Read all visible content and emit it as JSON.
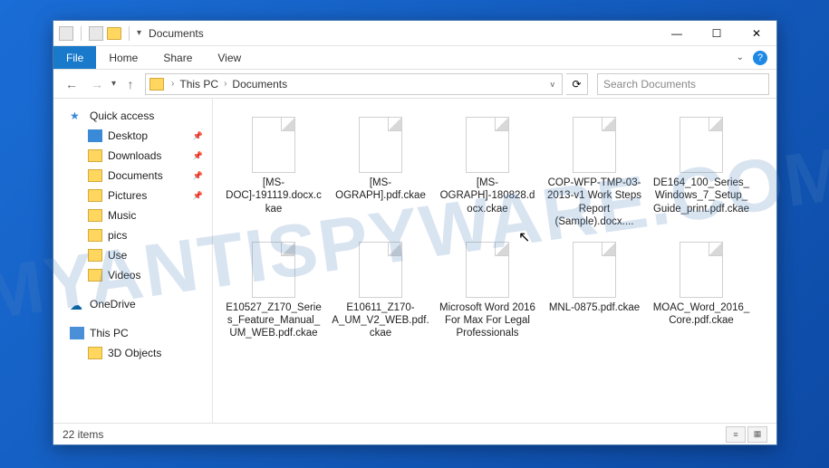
{
  "watermark": "MYANTISPYWARE.COM",
  "window": {
    "title": "Documents"
  },
  "ribbon": {
    "file": "File",
    "tabs": [
      "Home",
      "Share",
      "View"
    ]
  },
  "nav": {
    "back": "←",
    "forward": "→",
    "up": "↑",
    "breadcrumb": [
      "This PC",
      "Documents"
    ],
    "refresh": "⟳"
  },
  "search": {
    "placeholder": "Search Documents"
  },
  "sidebar": {
    "quick_access": "Quick access",
    "items": [
      {
        "label": "Desktop",
        "pinned": true,
        "icon": "desktop"
      },
      {
        "label": "Downloads",
        "pinned": true,
        "icon": "folder"
      },
      {
        "label": "Documents",
        "pinned": true,
        "icon": "folder"
      },
      {
        "label": "Pictures",
        "pinned": true,
        "icon": "folder"
      },
      {
        "label": "Music",
        "pinned": false,
        "icon": "folder"
      },
      {
        "label": "pics",
        "pinned": false,
        "icon": "folder"
      },
      {
        "label": "Use",
        "pinned": false,
        "icon": "folder"
      },
      {
        "label": "Videos",
        "pinned": false,
        "icon": "folder"
      }
    ],
    "onedrive": "OneDrive",
    "thispc": "This PC",
    "pc_items": [
      {
        "label": "3D Objects",
        "icon": "folder"
      }
    ]
  },
  "files": [
    {
      "name": "[MS-DOC]-191119.docx.ckae"
    },
    {
      "name": "[MS-OGRAPH].pdf.ckae"
    },
    {
      "name": "[MS-OGRAPH]-180828.docx.ckae"
    },
    {
      "name": "COP-WFP-TMP-03-2013-v1 Work Steps Report (Sample).docx...."
    },
    {
      "name": "DE164_100_Series_Windows_7_Setup_Guide_print.pdf.ckae"
    },
    {
      "name": "E10527_Z170_Series_Feature_Manual_UM_WEB.pdf.ckae"
    },
    {
      "name": "E10611_Z170-A_UM_V2_WEB.pdf.ckae"
    },
    {
      "name": "Microsoft Word 2016 For Max For Legal Professionals"
    },
    {
      "name": "MNL-0875.pdf.ckae"
    },
    {
      "name": "MOAC_Word_2016_Core.pdf.ckae"
    }
  ],
  "status": {
    "count": "22 items"
  }
}
